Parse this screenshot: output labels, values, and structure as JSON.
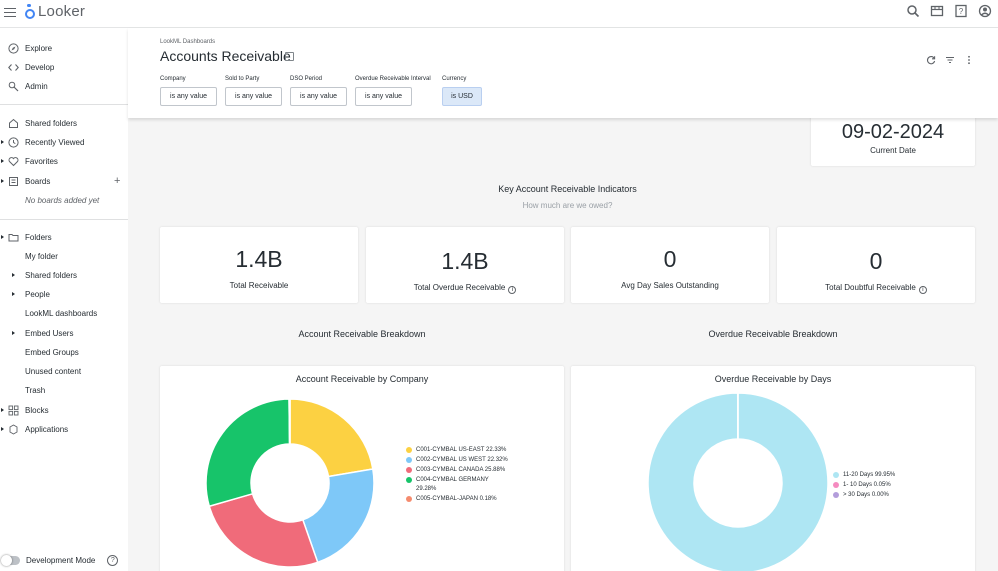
{
  "app": {
    "name": "Looker"
  },
  "sidebar": {
    "items": [
      {
        "label": "Explore",
        "icon": "compass-icon"
      },
      {
        "label": "Develop",
        "icon": "code-icon"
      },
      {
        "label": "Admin",
        "icon": "admin-icon"
      },
      {
        "label": "Shared folders",
        "icon": "home-icon"
      },
      {
        "label": "Recently Viewed",
        "icon": "clock-icon"
      },
      {
        "label": "Favorites",
        "icon": "heart-icon"
      },
      {
        "label": "Boards",
        "icon": "board-icon"
      },
      {
        "label": "No boards added yet"
      },
      {
        "label": "Folders",
        "icon": "folder-icon"
      },
      {
        "label": "My folder"
      },
      {
        "label": "Shared folders"
      },
      {
        "label": "People"
      },
      {
        "label": "LookML dashboards"
      },
      {
        "label": "Embed Users"
      },
      {
        "label": "Embed Groups"
      },
      {
        "label": "Unused content"
      },
      {
        "label": "Trash"
      },
      {
        "label": "Blocks",
        "icon": "blocks-icon"
      },
      {
        "label": "Applications",
        "icon": "applications-icon"
      }
    ],
    "dev_mode_label": "Development Mode"
  },
  "header": {
    "breadcrumb": "LookML Dashboards",
    "title": "Accounts Receivable",
    "filters": [
      {
        "label": "Company",
        "value": "is any value"
      },
      {
        "label": "Sold to Party",
        "value": "is any value"
      },
      {
        "label": "DSO Period",
        "value": "is any value"
      },
      {
        "label": "Overdue Receivable Interval",
        "value": "is any value"
      },
      {
        "label": "Currency",
        "value": "is USD"
      }
    ]
  },
  "date_tile": {
    "value": "09-02-2024",
    "label": "Current Date"
  },
  "kpi_section": {
    "title": "Key Account Receivable Indicators",
    "subtitle": "How much are we owed?"
  },
  "kpis": [
    {
      "value": "1.4B",
      "label": "Total Receivable"
    },
    {
      "value": "1.4B",
      "label": "Total Overdue Receivable"
    },
    {
      "value": "0",
      "label": "Avg Day Sales Outstanding"
    },
    {
      "value": "0",
      "label": "Total Doubtful Receivable"
    }
  ],
  "breakdown": {
    "left_title": "Account Receivable Breakdown",
    "right_title": "Overdue Receivable Breakdown"
  },
  "chart_data": [
    {
      "type": "pie",
      "title": "Account Receivable by Company",
      "categories": [
        "C001-CYMBAL US-EAST",
        "C002-CYMBAL US WEST",
        "C003-CYMBAL CANADA",
        "C004-CYMBAL GERMANY",
        "C005-CYMBAL-JAPAN"
      ],
      "values": [
        22.33,
        22.32,
        25.88,
        29.28,
        0.18
      ],
      "value_labels": [
        "22.33%",
        "22.32%",
        "25.88%",
        "29.28%",
        "0.18%"
      ],
      "colors": [
        "#fcd142",
        "#7ec8f8",
        "#f06b7a",
        "#17c46a",
        "#f58b6e"
      ],
      "legend": "right"
    },
    {
      "type": "pie",
      "title": "Overdue Receivable by Days",
      "categories": [
        "11-20 Days",
        "1- 10 Days",
        "> 30 Days"
      ],
      "values": [
        99.95,
        0.05,
        0.0
      ],
      "value_labels": [
        "99.95%",
        "0.05%",
        "0.00%"
      ],
      "colors": [
        "#aee6f3",
        "#f58bc0",
        "#b39ddb"
      ],
      "legend": "right"
    }
  ]
}
